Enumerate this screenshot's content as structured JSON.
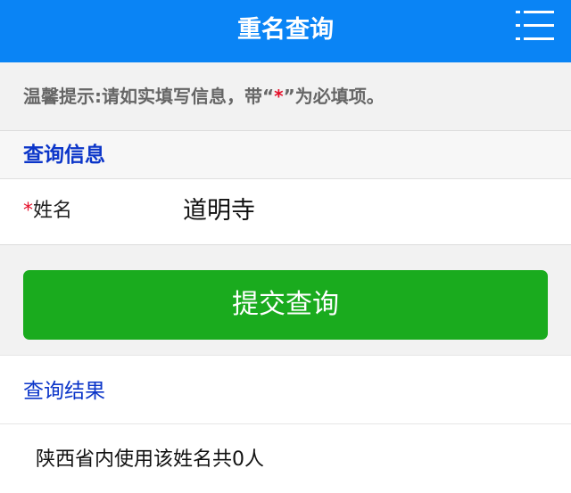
{
  "header": {
    "title": "重名查询",
    "menu_icon": "menu-icon"
  },
  "notice": {
    "prefix": "温馨提示:请如实填写信息，带“",
    "star": "*",
    "suffix": "”为必填项。"
  },
  "query_section": {
    "title": "查询信息"
  },
  "form": {
    "required_mark": "*",
    "name_label": "姓名",
    "name_value": "道明寺"
  },
  "submit": {
    "label": "提交查询"
  },
  "result": {
    "title": "查询结果",
    "text": "陕西省内使用该姓名共0人"
  },
  "colors": {
    "header_bg": "#0a84f5",
    "button_bg": "#1aab1e",
    "section_title": "#0b35c9",
    "required_star": "#e5102a"
  }
}
